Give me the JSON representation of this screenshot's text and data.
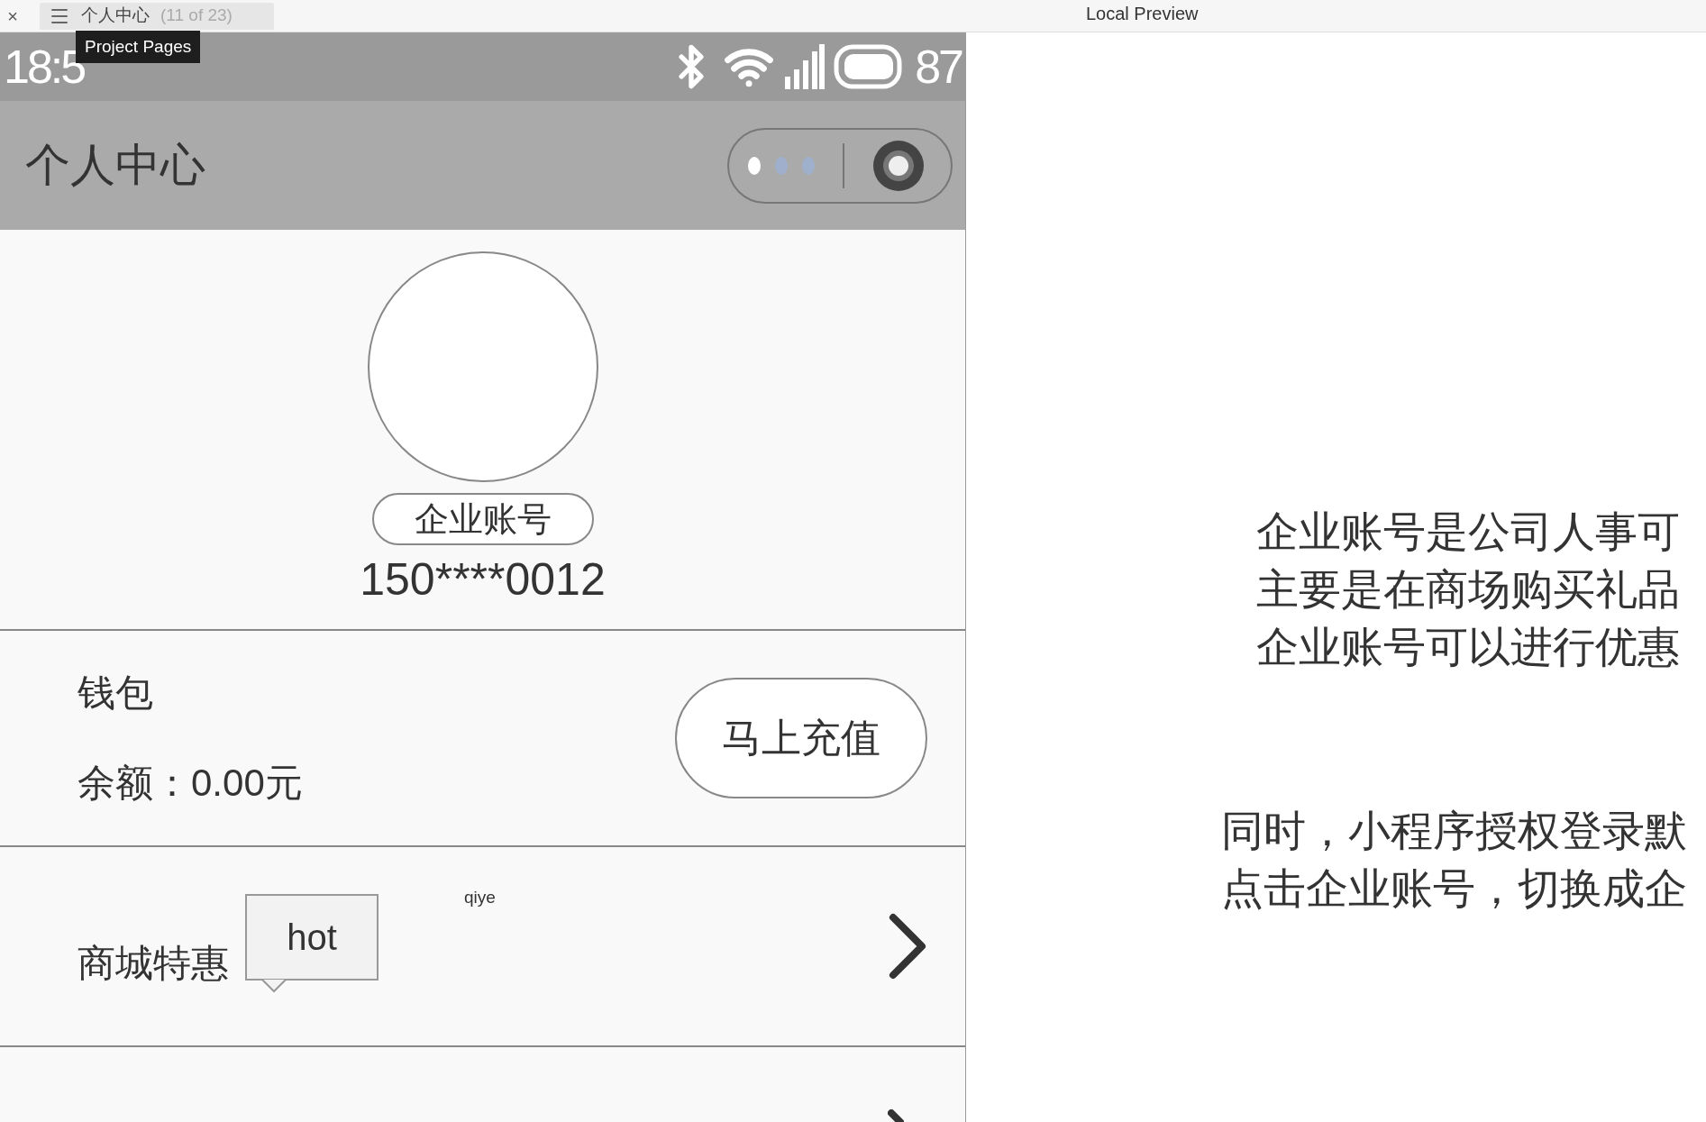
{
  "toolbar": {
    "close": "×",
    "page_tab": {
      "title": "个人中心",
      "count": "(11 of 23)"
    },
    "tooltip": "Project Pages",
    "preview_title": "Local Preview"
  },
  "phone": {
    "status_bar": {
      "time": "18:5",
      "battery": "87"
    },
    "nav": {
      "title": "个人中心"
    },
    "profile": {
      "badge": "企业账号",
      "phone": "150****0012"
    },
    "wallet": {
      "title": "钱包",
      "balance": "余额：0.00元",
      "button": "马上充值"
    },
    "rows": [
      {
        "label": "商城特惠",
        "tag": "hot",
        "note": "qiye"
      }
    ]
  },
  "notes": {
    "paragraphs": [
      [
        "企业账号是公司人事可",
        "主要是在商场购买礼品",
        "企业账号可以进行优惠"
      ],
      [
        "同时，小程序授权登录默",
        "点击企业账号，切换成企"
      ]
    ]
  }
}
